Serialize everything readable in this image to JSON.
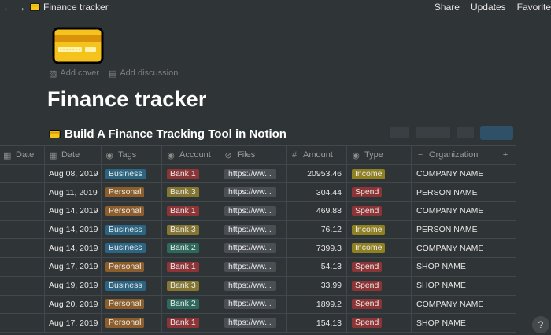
{
  "topbar": {
    "back_glyph": "←",
    "forward_glyph": "→",
    "breadcrumb": "Finance tracker",
    "share": "Share",
    "updates": "Updates",
    "favorite": "Favorite"
  },
  "page": {
    "add_cover": "Add cover",
    "add_discussion": "Add discussion",
    "title": "Finance tracker"
  },
  "database": {
    "title": "Build A Finance Tracking Tool in Notion",
    "columns": {
      "date0": "Date",
      "date": "Date",
      "tags": "Tags",
      "account": "Account",
      "files": "Files",
      "amount": "Amount",
      "type": "Type",
      "organization": "Organization",
      "add": "+"
    },
    "rows": [
      {
        "date": "Aug 08, 2019",
        "tag": "Business",
        "tag_kind": "business",
        "account": "Bank 1",
        "acct_kind": "bank1",
        "file": "https://ww...",
        "amount": "20953.46",
        "type": "Income",
        "type_kind": "income",
        "org": "COMPANY NAME"
      },
      {
        "date": "Aug 11, 2019",
        "tag": "Personal",
        "tag_kind": "personal",
        "account": "Bank 3",
        "acct_kind": "bank3",
        "file": "https://ww...",
        "amount": "304.44",
        "type": "Spend",
        "type_kind": "spend",
        "org": "PERSON NAME"
      },
      {
        "date": "Aug 14, 2019",
        "tag": "Personal",
        "tag_kind": "personal",
        "account": "Bank 1",
        "acct_kind": "bank1",
        "file": "https://ww...",
        "amount": "469.88",
        "type": "Spend",
        "type_kind": "spend",
        "org": "COMPANY NAME"
      },
      {
        "date": "Aug 14, 2019",
        "tag": "Business",
        "tag_kind": "business",
        "account": "Bank 3",
        "acct_kind": "bank3",
        "file": "https://ww...",
        "amount": "76.12",
        "type": "Income",
        "type_kind": "income",
        "org": "PERSON NAME"
      },
      {
        "date": "Aug 14, 2019",
        "tag": "Business",
        "tag_kind": "business",
        "account": "Bank 2",
        "acct_kind": "bank2",
        "file": "https://ww...",
        "amount": "7399.3",
        "type": "Income",
        "type_kind": "income",
        "org": "COMPANY NAME"
      },
      {
        "date": "Aug 17, 2019",
        "tag": "Personal",
        "tag_kind": "personal",
        "account": "Bank 1",
        "acct_kind": "bank1",
        "file": "https://ww...",
        "amount": "54.13",
        "type": "Spend",
        "type_kind": "spend",
        "org": "SHOP NAME"
      },
      {
        "date": "Aug 19, 2019",
        "tag": "Business",
        "tag_kind": "business",
        "account": "Bank 3",
        "acct_kind": "bank3",
        "file": "https://ww...",
        "amount": "33.99",
        "type": "Spend",
        "type_kind": "spend",
        "org": "SHOP NAME"
      },
      {
        "date": "Aug 20, 2019",
        "tag": "Personal",
        "tag_kind": "personal",
        "account": "Bank 2",
        "acct_kind": "bank2",
        "file": "https://ww...",
        "amount": "1899.2",
        "type": "Spend",
        "type_kind": "spend",
        "org": "COMPANY NAME"
      },
      {
        "date": "Aug 17, 2019",
        "tag": "Personal",
        "tag_kind": "personal",
        "account": "Bank 1",
        "acct_kind": "bank1",
        "file": "https://ww...",
        "amount": "154.13",
        "type": "Spend",
        "type_kind": "spend",
        "org": "SHOP NAME"
      }
    ]
  },
  "help": "?",
  "colors": {
    "background": "#2f3437",
    "business": "#2b6583",
    "personal": "#8c5e2b",
    "bank1": "#8d3536",
    "bank2": "#2d6a5c",
    "bank3": "#857732",
    "income": "#8f8022",
    "spend": "#8d3536",
    "card_yellow": "#f5c518"
  },
  "icons": [
    "credit-card-icon",
    "image-icon",
    "comment-icon",
    "calendar-icon",
    "tag-icon",
    "file-icon",
    "hash-icon",
    "text-icon",
    "plus-icon"
  ]
}
